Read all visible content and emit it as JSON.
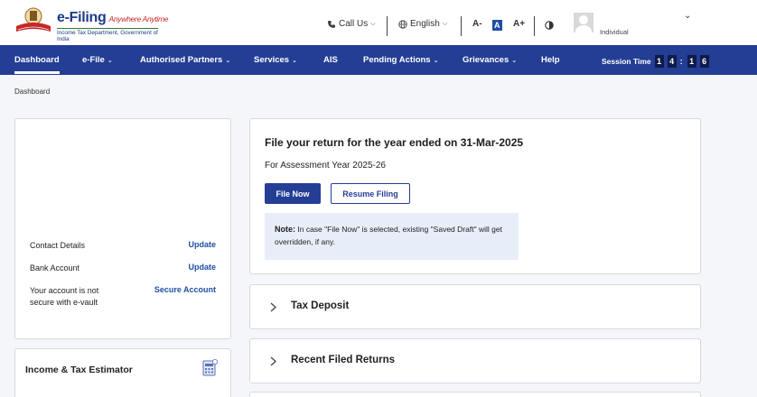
{
  "header": {
    "brand_title": "e-Filing",
    "brand_tagline": "Anywhere Anytime",
    "brand_subtitle": "Income Tax Department, Government of India",
    "call_us": "Call Us",
    "language": "English",
    "font_decrease": "A-",
    "font_normal": "A",
    "font_increase": "A+",
    "contrast_icon": "contrast-icon",
    "user_role": "Individual"
  },
  "nav": {
    "items": [
      {
        "label": "Dashboard",
        "dropdown": false,
        "active": true
      },
      {
        "label": "e-File",
        "dropdown": true
      },
      {
        "label": "Authorised Partners",
        "dropdown": true
      },
      {
        "label": "Services",
        "dropdown": true
      },
      {
        "label": "AIS",
        "dropdown": false
      },
      {
        "label": "Pending Actions",
        "dropdown": true
      },
      {
        "label": "Grievances",
        "dropdown": true
      },
      {
        "label": "Help",
        "dropdown": false
      }
    ],
    "session_label": "Session Time",
    "session_digits": [
      "1",
      "4",
      "1",
      "6"
    ]
  },
  "breadcrumb": "Dashboard",
  "profile": {
    "contact_label": "Contact Details",
    "contact_link": "Update",
    "bank_label": "Bank Account",
    "bank_link": "Update",
    "secure_label": "Your account is not secure with e-vault",
    "secure_link": "Secure Account"
  },
  "estimator": {
    "title": "Income & Tax Estimator"
  },
  "return_card": {
    "title": "File your return for the year ended on 31-Mar-2025",
    "assessment_year": "For Assessment Year 2025-26",
    "file_now": "File Now",
    "resume_filing": "Resume Filing",
    "note_label": "Note:",
    "note_text": "In case \"File Now\" is selected, existing \"Saved Draft\" will get overridden, if any."
  },
  "accordions": [
    {
      "title": "Tax Deposit"
    },
    {
      "title": "Recent Filed Returns"
    }
  ],
  "colors": {
    "nav_bg": "#243e95",
    "link": "#1f4fa6",
    "note_bg": "#e8eef9"
  }
}
